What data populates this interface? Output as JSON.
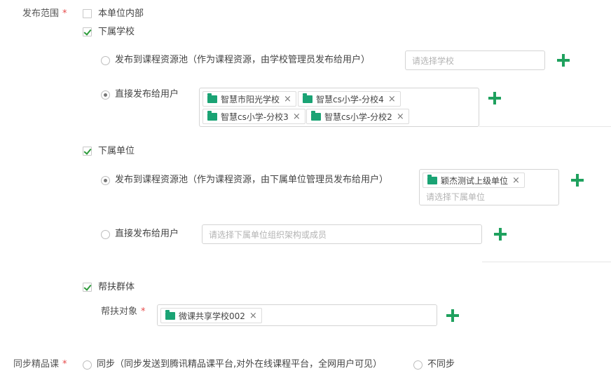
{
  "scope": {
    "label": "发布范围",
    "required_mark": "*",
    "own_unit": {
      "label": "本单位内部",
      "checked": false
    },
    "schools": {
      "label": "下属学校",
      "checked": true,
      "pool": {
        "label": "发布到课程资源池（作为课程资源，由学校管理员发布给用户）",
        "selected": false,
        "placeholder": "请选择学校"
      },
      "direct": {
        "label": "直接发布给用户",
        "selected": true,
        "tags": [
          "智慧市阳光学校",
          "智慧cs小学-分校4",
          "智慧cs小学-分校3",
          "智慧cs小学-分校2"
        ]
      }
    },
    "units": {
      "label": "下属单位",
      "checked": true,
      "pool": {
        "label": "发布到课程资源池（作为课程资源，由下属单位管理员发布给用户）",
        "selected": true,
        "tags": [
          "颖杰测试上级单位"
        ],
        "placeholder": "请选择下属单位"
      },
      "direct": {
        "label": "直接发布给用户",
        "selected": false,
        "placeholder": "请选择下属单位组织架构或成员"
      }
    },
    "aid": {
      "label": "帮扶群体",
      "checked": true,
      "target_label": "帮扶对象",
      "tags": [
        "微课共享学校002"
      ]
    }
  },
  "sync": {
    "label": "同步精品课",
    "required_mark": "*",
    "option_sync": "同步（同步发送到腾讯精品课平台,对外在线课程平台，全网用户可见）",
    "option_nosync": "不同步"
  },
  "icons": {
    "remove": "×",
    "add": "plus-icon",
    "folder": "folder-icon"
  },
  "colors": {
    "accent": "#1fa15e",
    "folder": "#1aa374",
    "required": "#e64a4a"
  }
}
